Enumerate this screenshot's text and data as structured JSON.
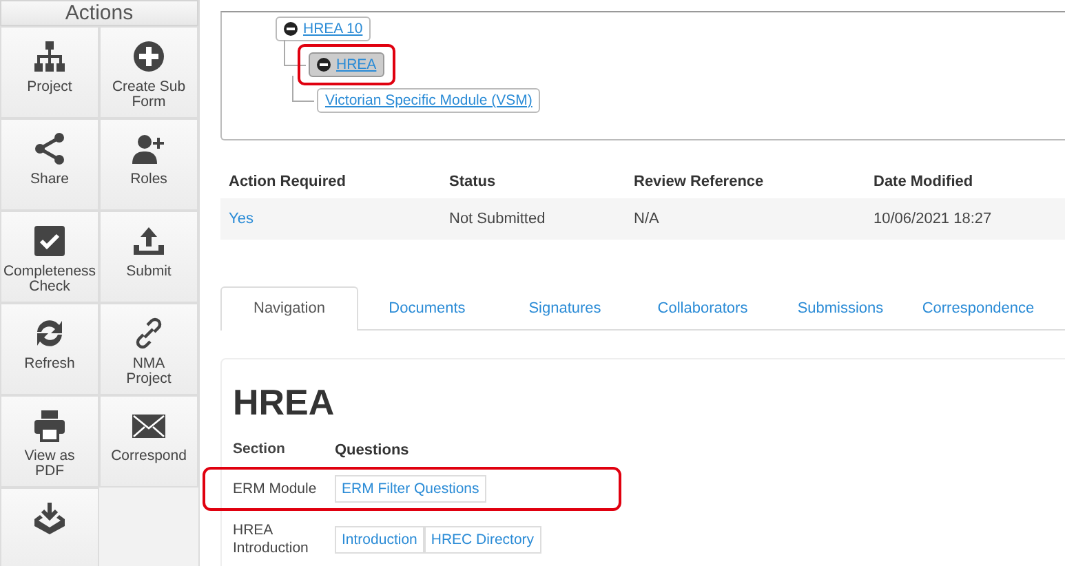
{
  "sidebar": {
    "title": "Actions",
    "items": [
      {
        "kind": "labeled",
        "label": "Project"
      },
      {
        "kind": "labeled",
        "label": "Create Sub Form"
      },
      {
        "kind": "labeled",
        "label": "Share"
      },
      {
        "kind": "labeled",
        "label": "Roles"
      },
      {
        "kind": "labeled",
        "label": "Completeness Check"
      },
      {
        "kind": "labeled",
        "label": "Submit"
      },
      {
        "kind": "labeled",
        "label": "Refresh"
      },
      {
        "kind": "labeled",
        "label": "NMA Project"
      },
      {
        "kind": "labeled",
        "label": "View as PDF"
      },
      {
        "kind": "labeled",
        "label": "Correspond"
      },
      {
        "kind": "icon_only"
      }
    ]
  },
  "tree": [
    {
      "label": "HREA 10",
      "selected": false,
      "annotated": false,
      "children": [
        {
          "label": "HREA",
          "selected": true,
          "annotated": true,
          "children": [
            {
              "label": "Victorian Specific Module (VSM)",
              "selected": false,
              "annotated": false
            }
          ]
        }
      ]
    }
  ],
  "summary": {
    "columns": [
      "Action Required",
      "Status",
      "Review Reference",
      "Date Modified"
    ],
    "row": [
      {
        "text": "Yes",
        "kind": "link"
      },
      {
        "text": "Not Submitted",
        "kind": "text"
      },
      {
        "text": "N/A",
        "kind": "text"
      },
      {
        "text": "10/06/2021 18:27",
        "kind": "text"
      }
    ]
  },
  "tabs": [
    {
      "label": "Navigation",
      "selected": true
    },
    {
      "label": "Documents",
      "selected": false
    },
    {
      "label": "Signatures",
      "selected": false
    },
    {
      "label": "Collaborators",
      "selected": false
    },
    {
      "label": "Submissions",
      "selected": false
    },
    {
      "label": "Correspondence",
      "selected": false
    }
  ],
  "content": {
    "title": "HREA",
    "columns": [
      "Section",
      "Questions"
    ],
    "rows": [
      {
        "section": "ERM Module",
        "annotated": true,
        "questions": [
          "ERM Filter Questions"
        ]
      },
      {
        "section": "HREA Introduction",
        "annotated": false,
        "questions": [
          "Introduction",
          "HREC Directory"
        ]
      }
    ]
  }
}
